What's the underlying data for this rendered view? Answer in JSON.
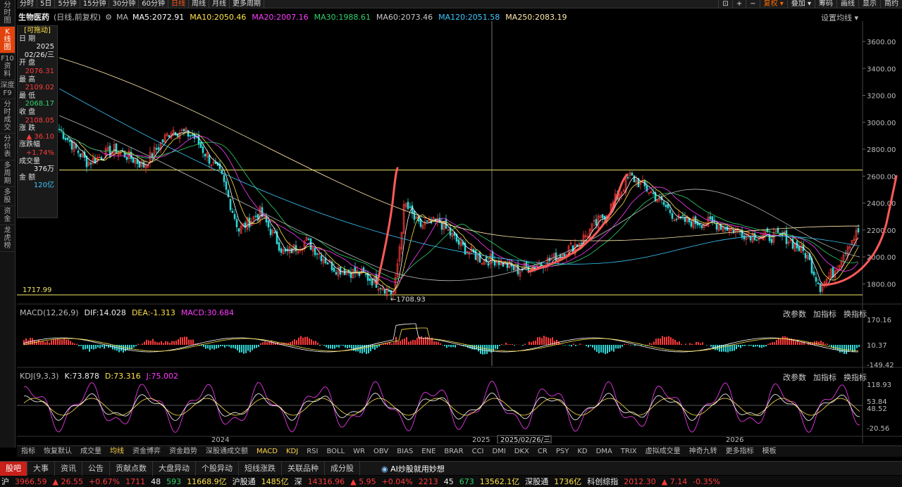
{
  "periods": [
    "分时",
    "5日",
    "5分钟",
    "15分钟",
    "30分钟",
    "60分钟",
    "日线",
    "周线",
    "月线",
    "更多周期"
  ],
  "active_period": "日线",
  "top_right": [
    "复权",
    "叠加",
    "筹码",
    "画线",
    "显示",
    "简约"
  ],
  "left_nav": [
    "分\n时\n图",
    "K\n线\n图",
    "F10\n资\n料",
    "深度\nF9",
    "分\n时\n成\n交",
    "分\n价\n表",
    "多\n周\n期",
    "多\n股",
    "资\n金",
    "龙\n虎\n榜"
  ],
  "ma_bar": {
    "name": "生物医药",
    "mode": "(日线,前复权)",
    "ma_label": "MA",
    "items": [
      {
        "text": "MA5:2072.91",
        "color": "#ffffff"
      },
      {
        "text": "MA10:2050.46",
        "color": "#ffe24a"
      },
      {
        "text": "MA20:2007.16",
        "color": "#ff3cff"
      },
      {
        "text": "MA30:1988.61",
        "color": "#2ed36b"
      },
      {
        "text": "MA60:2073.46",
        "color": "#c8c8c8"
      },
      {
        "text": "MA120:2051.58",
        "color": "#3cc8ff"
      },
      {
        "text": "MA250:2083.19",
        "color": "#ffe9a8"
      }
    ],
    "set_ma": "设置均线"
  },
  "info": {
    "drag": "[可拖动]",
    "date_label": "日 期",
    "year": "2025",
    "date": "02/26",
    "weekday": "三",
    "open_label": "开 盘",
    "open": "2076.31",
    "high_label": "最 高",
    "high": "2109.02",
    "low_label": "最 低",
    "low": "2068.17",
    "close_label": "收 盘",
    "close": "2108.05",
    "chg_label": "涨 跌",
    "chg": "▲ 36.10",
    "pct_label": "涨跌幅",
    "pct": "+1.74%",
    "vol_label": "成交量",
    "vol": "376万",
    "amt_label": "金 额",
    "amt": "120亿"
  },
  "price_axis": {
    "ticks": [
      "3600.00",
      "3400.00",
      "3200.00",
      "3000.00",
      "2800.00",
      "2600.00",
      "2400.00",
      "2200.00",
      "2000.00",
      "1800.00"
    ],
    "low_label": "1717.99",
    "min_label": "←1708.93"
  },
  "macd": {
    "label": "MACD(12,26,9)",
    "dif": "DIF:14.028",
    "dea": "DEA:-1.313",
    "macd": "MACD:30.684",
    "ticks": [
      "170.16",
      "10.37",
      "-149.42"
    ],
    "right": [
      "改参数",
      "加指标",
      "换指标"
    ]
  },
  "kdj": {
    "label": "KDJ(9,3,3)",
    "k": "K:73.878",
    "d": "D:73.316",
    "j": "J:75.002",
    "ticks": [
      "118.93",
      "53.84",
      "48.52",
      "-20.56"
    ],
    "right": [
      "改参数",
      "加指标",
      "换指标"
    ]
  },
  "x_axis": {
    "labels": [
      "2024",
      "2025",
      "2026"
    ],
    "cursor": "2025/02/26/三"
  },
  "indicator_tabs": [
    "指标",
    "恢复默认",
    "成交量",
    "均线",
    "资金博弈",
    "资金趋势",
    "深股通成交额",
    "MACD",
    "KDJ",
    "RSI",
    "BOLL",
    "WR",
    "OBV",
    "BIAS",
    "ENE",
    "BRAR",
    "CCI",
    "DMI",
    "DKX",
    "CR",
    "PSY",
    "KD",
    "DMA",
    "TRIX",
    "虚拟成交量",
    "神奇九转",
    "更多指标",
    "模板"
  ],
  "news_tabs": [
    "股吧",
    "大事",
    "资讯",
    "公告",
    "贡献点数",
    "大盘异动",
    "个股异动",
    "短线涨跌",
    "关联品种",
    "成分股"
  ],
  "ai_text": "AI炒股就用妙想",
  "ticker": [
    {
      "t": "沪",
      "c": "white"
    },
    {
      "t": "3966.59",
      "c": "red"
    },
    {
      "t": "▲ 26.55",
      "c": "red"
    },
    {
      "t": "+0.67%",
      "c": "red"
    },
    {
      "t": "1711",
      "c": "red"
    },
    {
      "t": "48",
      "c": "white"
    },
    {
      "t": "593",
      "c": "green"
    },
    {
      "t": "11668.9亿",
      "c": "yellow"
    },
    {
      "t": "沪股通",
      "c": "white"
    },
    {
      "t": "1485亿",
      "c": "yellow"
    },
    {
      "t": "深",
      "c": "white"
    },
    {
      "t": "14316.96",
      "c": "red"
    },
    {
      "t": "▲ 5.95",
      "c": "red"
    },
    {
      "t": "+0.04%",
      "c": "red"
    },
    {
      "t": "2213",
      "c": "red"
    },
    {
      "t": "45",
      "c": "white"
    },
    {
      "t": "673",
      "c": "green"
    },
    {
      "t": "13562.1亿",
      "c": "yellow"
    },
    {
      "t": "深股通",
      "c": "white"
    },
    {
      "t": "1736亿",
      "c": "yellow"
    },
    {
      "t": "科创综指",
      "c": "white"
    },
    {
      "t": "2012.30",
      "c": "red"
    },
    {
      "t": "▲ 7.14",
      "c": "red"
    },
    {
      "t": "-0.35%",
      "c": "red"
    }
  ]
}
